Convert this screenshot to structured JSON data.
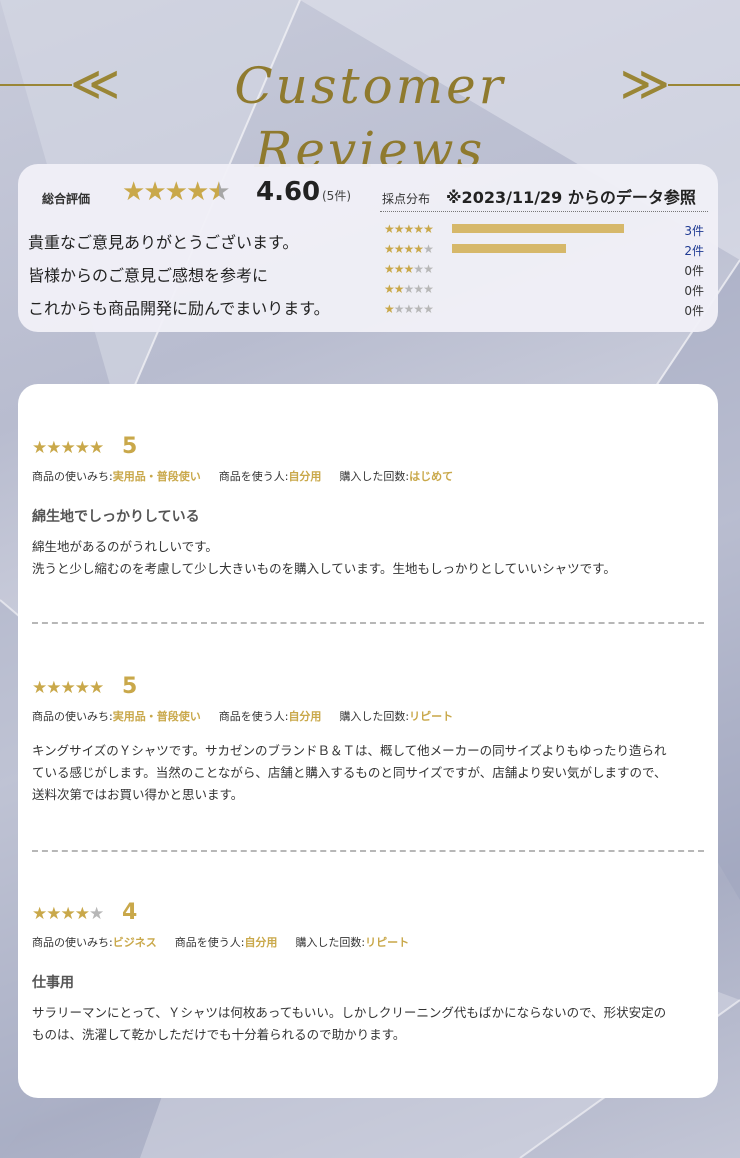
{
  "header": {
    "title": "Customer Reviews",
    "chevron_left": "≪",
    "chevron_right": "≫"
  },
  "summary": {
    "overall_label": "総合評価",
    "overall_rating": 4.6,
    "overall_score": "4.60",
    "overall_count": "(5件)",
    "message": [
      "貴重なご意見ありがとうございます。",
      "皆様からのご意見ご感想を参考に",
      "これからも商品開発に励んでまいります。"
    ],
    "distribution_label": "採点分布",
    "distribution_note": "※2023/11/29 からのデータ参照",
    "distribution": [
      {
        "stars": 5,
        "count": "3件",
        "fraction": 0.98
      },
      {
        "stars": 4,
        "count": "2件",
        "fraction": 0.65
      },
      {
        "stars": 3,
        "count": "0件",
        "fraction": 0
      },
      {
        "stars": 2,
        "count": "0件",
        "fraction": 0
      },
      {
        "stars": 1,
        "count": "0件",
        "fraction": 0
      }
    ]
  },
  "reviews": [
    {
      "stars": 5,
      "score": "5",
      "usage_label": "商品の使いみち:",
      "usage": "実用品・普段使い",
      "user_label": "商品を使う人:",
      "user": "自分用",
      "count_label": "購入した回数:",
      "count": "はじめて",
      "title": "綿生地でしっかりしている",
      "body": [
        "綿生地があるのがうれしいです。",
        "洗うと少し縮むのを考慮して少し大きいものを購入しています。生地もしっかりとしていいシャツです。"
      ]
    },
    {
      "stars": 5,
      "score": "5",
      "usage_label": "商品の使いみち:",
      "usage": "実用品・普段使い",
      "user_label": "商品を使う人:",
      "user": "自分用",
      "count_label": "購入した回数:",
      "count": "リピート",
      "title": "",
      "body": [
        "キングサイズのＹシャツです。サカゼンのブランドＢ＆Ｔは、概して他メーカーの同サイズよりもゆったり造られ",
        "ている感じがします。当然のことながら、店舗と購入するものと同サイズですが、店舗より安い気がしますので、",
        "送料次第ではお買い得かと思います。"
      ]
    },
    {
      "stars": 4,
      "score": "4",
      "usage_label": "商品の使いみち:",
      "usage": "ビジネス",
      "user_label": "商品を使う人:",
      "user": "自分用",
      "count_label": "購入した回数:",
      "count": "リピート",
      "title": "仕事用",
      "body": [
        "サラリーマンにとって、Ｙシャツは何枚あってもいい。しかしクリーニング代もばかにならないので、形状安定の",
        "ものは、洗濯して乾かしただけでも十分着られるので助かります。"
      ]
    }
  ],
  "colors": {
    "gold": "#c9a84a",
    "bar": "#d6b86a",
    "link": "#1f3a93"
  }
}
